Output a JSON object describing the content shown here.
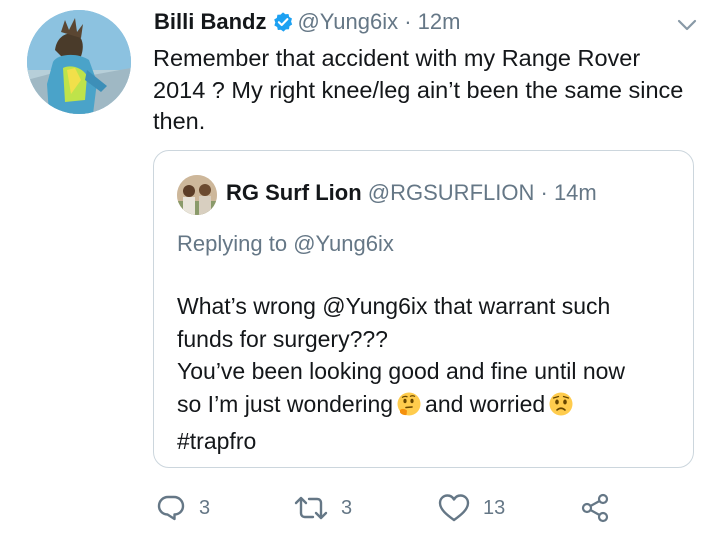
{
  "tweet": {
    "author_name": "Billi Bandz",
    "handle": "@Yung6ix",
    "separator": "·",
    "time": "12m",
    "text": "Remember that accident with my Range Rover 2014 ? My right knee/leg ain’t  been the same since then."
  },
  "quoted_tweet": {
    "author_name": "RG Surf Lion",
    "handle": "@RGSURFLION",
    "separator": "·",
    "time": "14m",
    "replying_prefix": "Replying to",
    "replying_to": "@Yung6ix",
    "line1": "What’s wrong @Yung6ix that warrant such",
    "line2": "funds for surgery???",
    "line3": "You’ve been looking good and fine until now",
    "line4_a": "so I’m just wondering",
    "line4_b": "and worried",
    "line5": "#trapfro"
  },
  "actions": {
    "replies": "3",
    "retweets": "3",
    "likes": "13"
  },
  "colors": {
    "text": "#14171a",
    "muted": "#657786",
    "verified": "#1da1f2",
    "border": "#ccd6dd"
  },
  "icons": [
    "verified-badge-icon",
    "chevron-down-icon",
    "thinking-face-emoji",
    "worried-face-emoji",
    "reply-icon",
    "retweet-icon",
    "like-icon",
    "share-icon"
  ]
}
